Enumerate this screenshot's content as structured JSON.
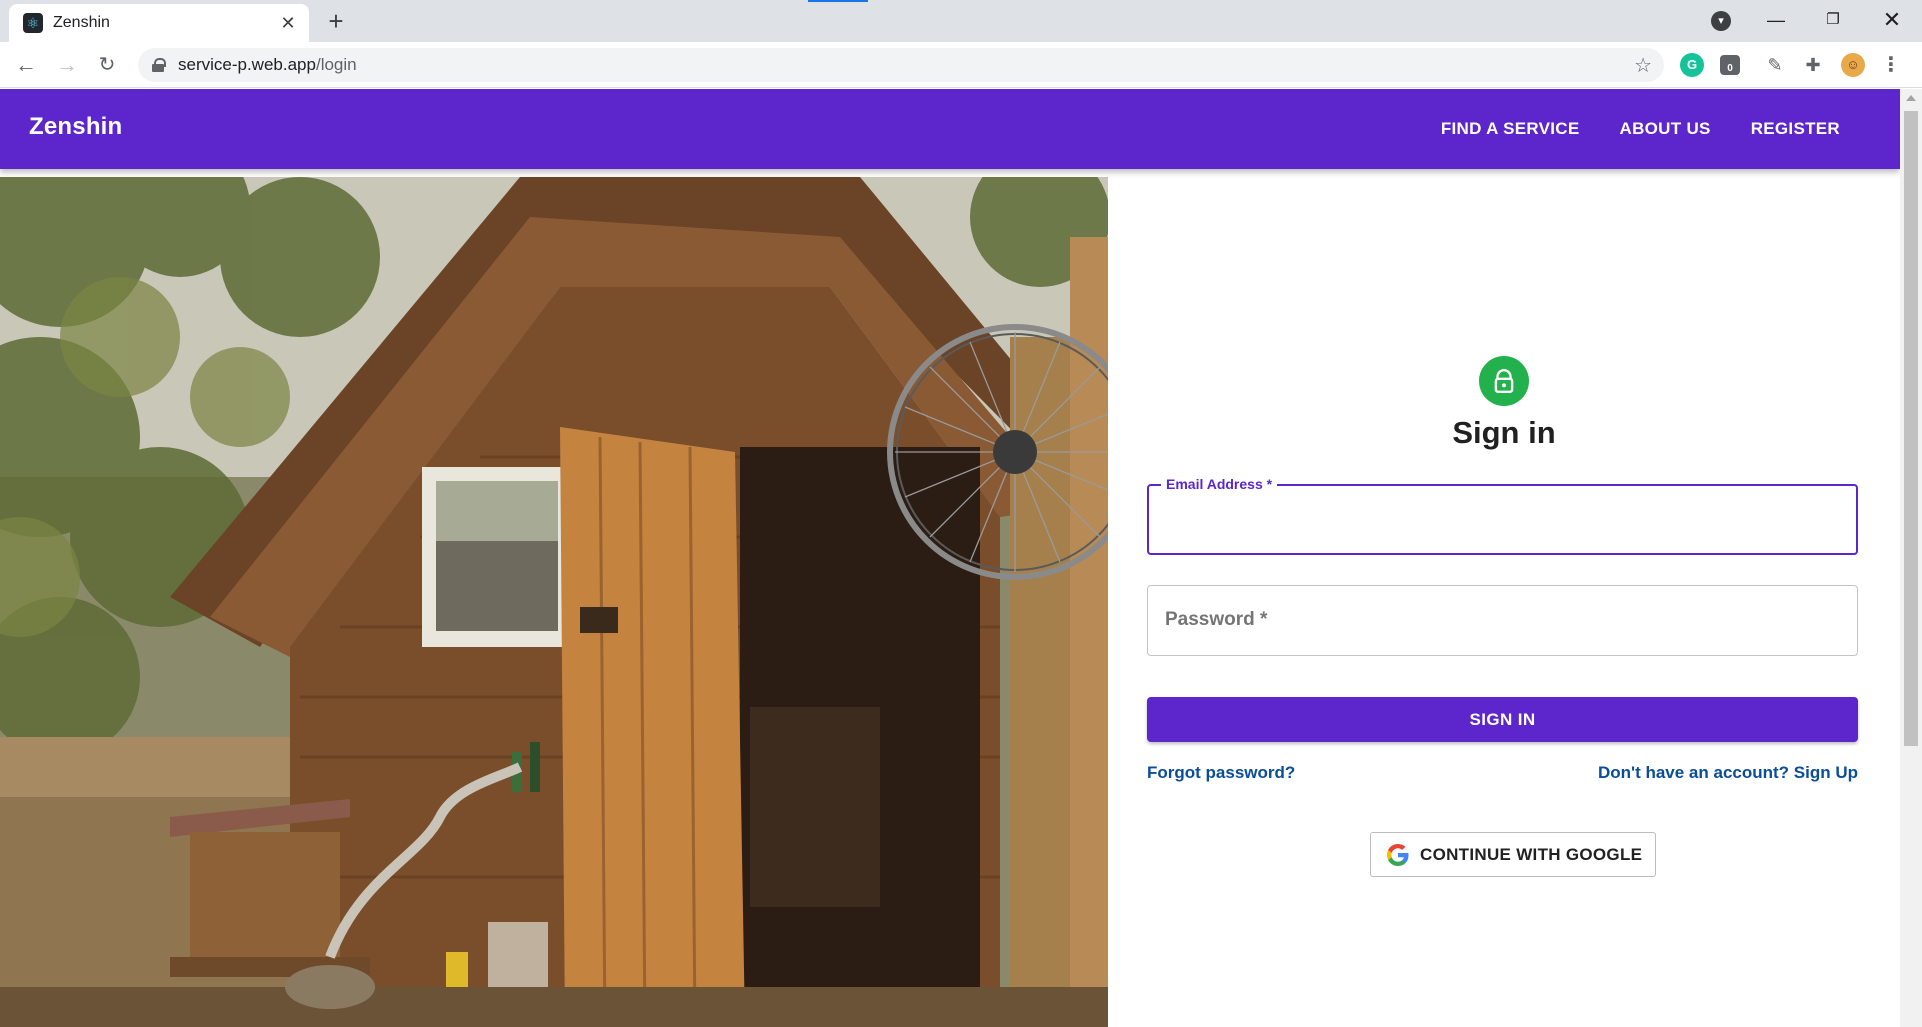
{
  "browser": {
    "tab_title": "Zenshin",
    "tab_close": "✕",
    "new_tab": "+",
    "url_host": "service-p.web.app",
    "url_path": "/login",
    "back": "←",
    "forward": "→",
    "reload": "↻",
    "star": "☆",
    "minimize": "—",
    "maximize": "❐",
    "close": "✕",
    "extensions": [
      "grammarly-icon",
      "extension-icon",
      "eyedropper-icon",
      "puzzle-icon",
      "profile-avatar",
      "menu-icon"
    ],
    "extension_badge": "0"
  },
  "header": {
    "brand": "Zenshin",
    "nav": [
      {
        "label": "FIND A SERVICE"
      },
      {
        "label": "ABOUT US"
      },
      {
        "label": "REGISTER"
      }
    ],
    "color": "#5c26cc"
  },
  "signin": {
    "title": "Sign in",
    "lock_color": "#22b14c",
    "email_label": "Email Address *",
    "email_value": "",
    "password_label": "Password *",
    "submit_label": "SIGN IN",
    "forgot_label": "Forgot password?",
    "signup_label": "Don't have an account? Sign Up",
    "google_label": "CONTINUE WITH GOOGLE"
  }
}
